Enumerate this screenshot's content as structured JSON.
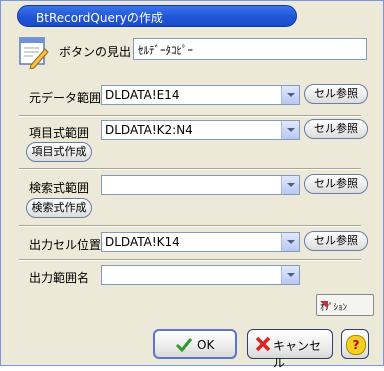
{
  "window": {
    "title": "BtRecordQueryの作成"
  },
  "caption": {
    "label": "ボタンの見出し",
    "value": "ｾﾙﾃﾞｰﾀｺﾋﾟｰ"
  },
  "source_range": {
    "label": "元データ範囲",
    "value": "DLDATA!E14",
    "ref_button": "セル参照"
  },
  "field_range": {
    "label": "項目式範囲",
    "value": "DLDATA!K2:N4",
    "ref_button": "セル参照",
    "create_button": "項目式作成"
  },
  "search_range": {
    "label": "検索式範囲",
    "value": "",
    "ref_button": "セル参照",
    "create_button": "検索式作成"
  },
  "output_cell": {
    "label": "出力セル位置",
    "value": "DLDATA!K14",
    "ref_button": "セル参照"
  },
  "output_name": {
    "label": "出力範囲名",
    "value": ""
  },
  "option_button": {
    "label": "ｵﾌﾟｼｮﾝ"
  },
  "footer": {
    "ok_label": "OK",
    "cancel_label": "キャンセル",
    "help_label": "?"
  }
}
